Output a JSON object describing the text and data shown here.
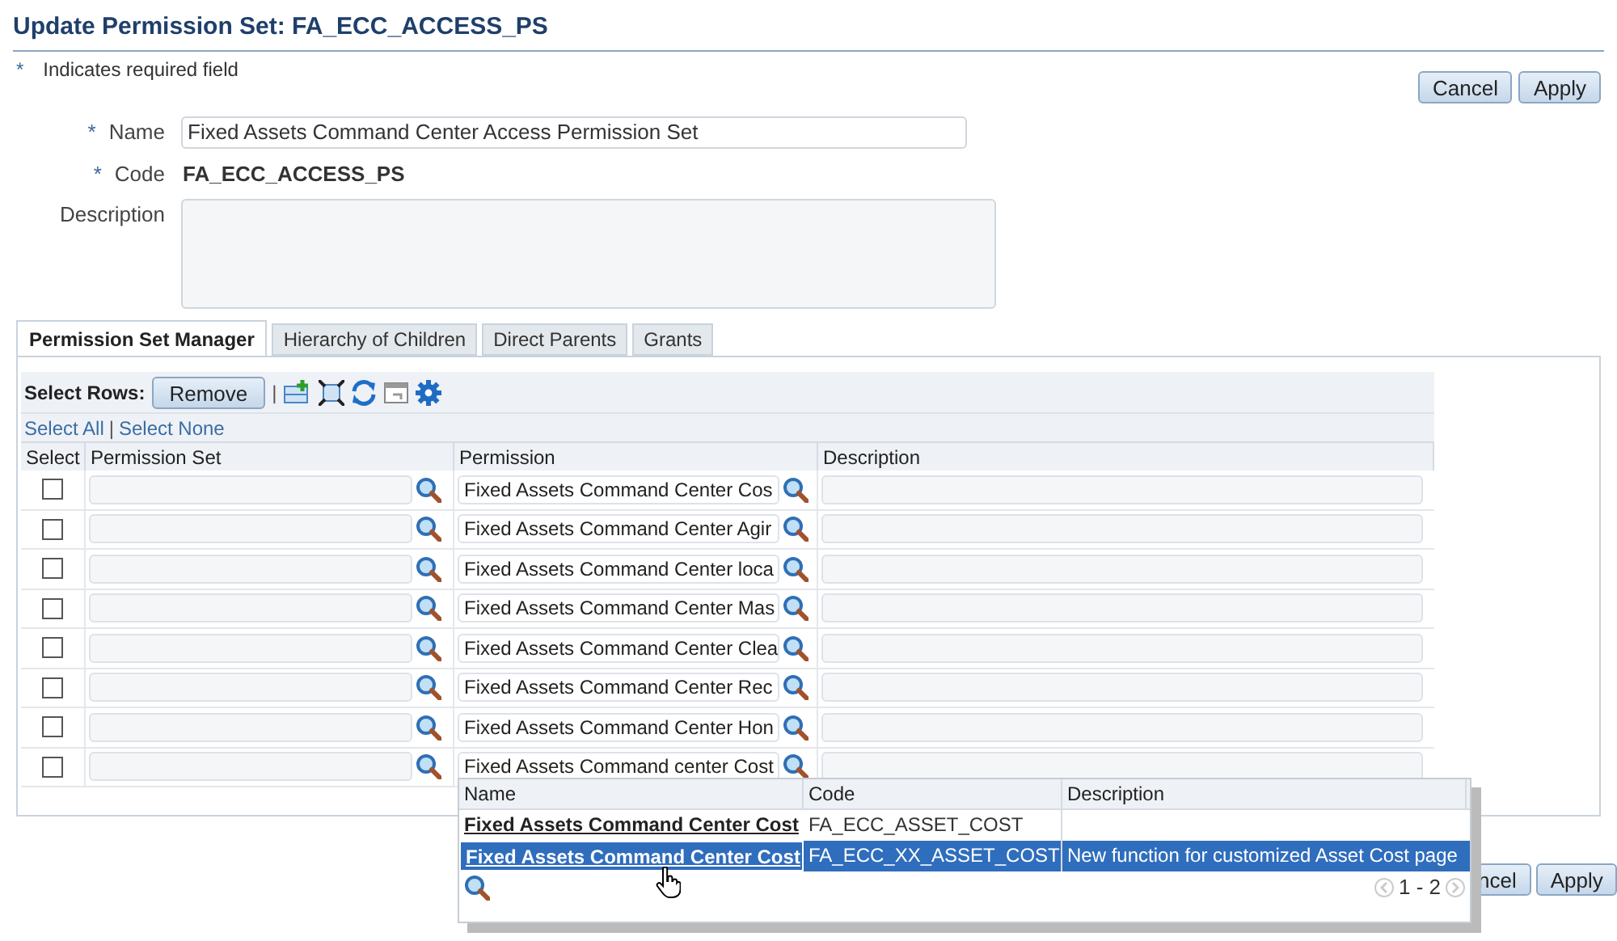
{
  "title": "Update Permission Set: FA_ECC_ACCESS_PS",
  "required_note": {
    "mark": "*",
    "text": "Indicates required field"
  },
  "header_buttons": [
    "Cancel",
    "Apply"
  ],
  "form": [
    {
      "kind": "input",
      "required": true,
      "label": "Name",
      "value": "Fixed Assets Command Center Access Permission Set"
    },
    {
      "kind": "readonly",
      "required": true,
      "label": "Code",
      "value": "FA_ECC_ACCESS_PS"
    },
    {
      "kind": "textarea",
      "required": false,
      "label": "Description"
    }
  ],
  "tabs": [
    {
      "label": "Permission Set Manager",
      "selected": true
    },
    {
      "label": "Hierarchy of Children",
      "selected": false
    },
    {
      "label": "Direct Parents",
      "selected": false
    },
    {
      "label": "Grants",
      "selected": false
    }
  ],
  "toolbar": {
    "label": "Select Rows:",
    "button": "Remove",
    "separator": "|"
  },
  "select_links": {
    "all": "Select All",
    "separator": "|",
    "none": "Select None"
  },
  "table": {
    "columns": [
      "Select",
      "Permission Set",
      "Permission",
      "Description"
    ],
    "rows": [
      {
        "checked": false,
        "permission": "Fixed Assets Command Center Cos"
      },
      {
        "checked": false,
        "permission": "Fixed Assets Command Center Agir"
      },
      {
        "checked": false,
        "permission": "Fixed Assets Command Center loca"
      },
      {
        "checked": false,
        "permission": "Fixed Assets Command Center Mas"
      },
      {
        "checked": false,
        "permission": "Fixed Assets Command Center Clea"
      },
      {
        "checked": false,
        "permission": "Fixed Assets Command Center Rec"
      },
      {
        "checked": false,
        "permission": "Fixed Assets Command Center Hon"
      },
      {
        "checked": false,
        "permission": "Fixed Assets Command center Cost"
      }
    ]
  },
  "popup": {
    "columns": [
      "Name",
      "Code",
      "Description"
    ],
    "rows": [
      {
        "selected": false,
        "name": "Fixed Assets Command Center Cost",
        "code": "FA_ECC_ASSET_COST"
      },
      {
        "selected": true,
        "name": "Fixed Assets Command Center Cost",
        "code": "FA_ECC_XX_ASSET_COST",
        "description": "New function for customized Asset Cost page"
      }
    ],
    "pager": "1 - 2"
  },
  "footer_buttons": [
    "ncel",
    "Apply"
  ]
}
